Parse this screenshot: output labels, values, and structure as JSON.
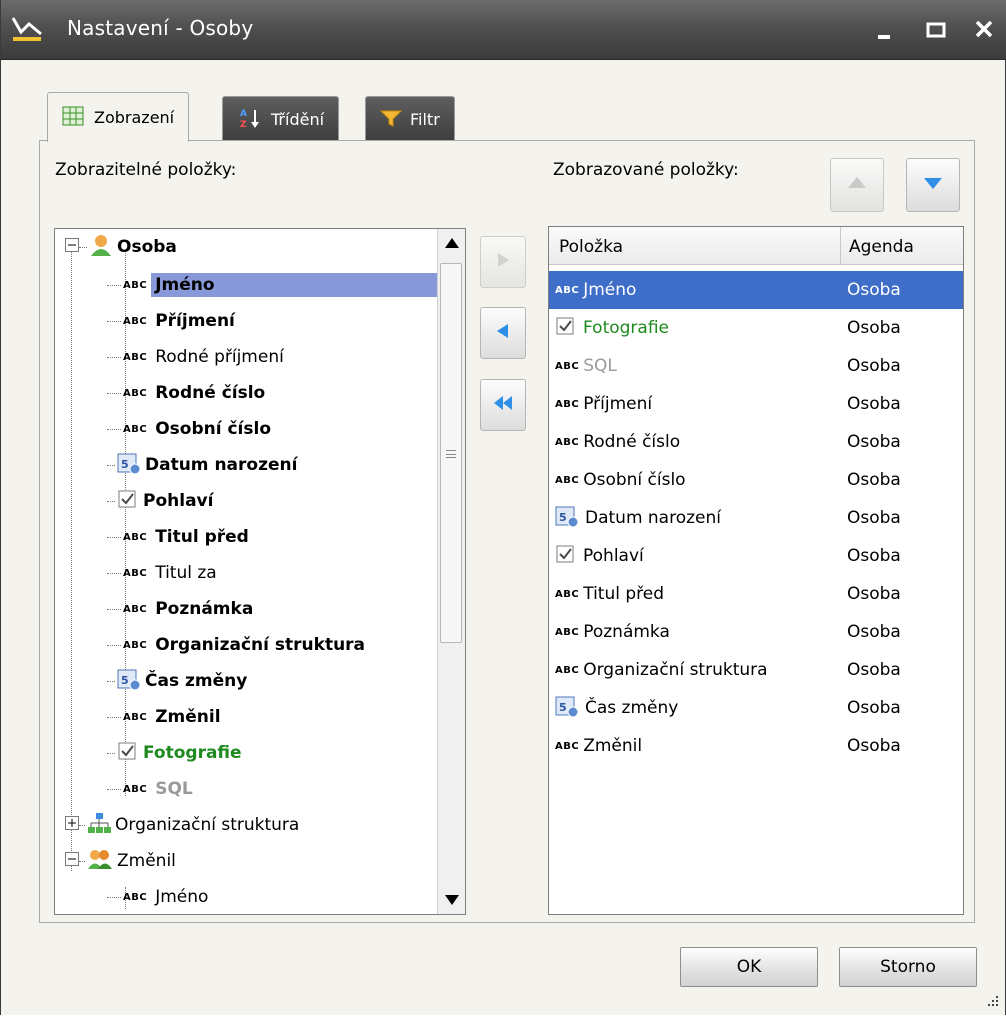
{
  "window": {
    "title": "Nastavení - Osoby"
  },
  "tabs": [
    {
      "label": "Zobrazení",
      "icon": "grid-icon",
      "active": true
    },
    {
      "label": "Třídění",
      "icon": "sort-az-icon",
      "active": false
    },
    {
      "label": "Filtr",
      "icon": "filter-icon",
      "active": false
    }
  ],
  "left_label": "Zobrazitelné položky:",
  "right_label": "Zobrazované položky:",
  "tree": {
    "items": [
      {
        "text": "Osoba",
        "icon": "person-icon",
        "level": 0,
        "bold": true,
        "expander": "minus"
      },
      {
        "text": "Jméno",
        "icon": "abc-icon",
        "level": 1,
        "bold": true,
        "selected": true
      },
      {
        "text": "Příjmení",
        "icon": "abc-icon",
        "level": 1,
        "bold": true
      },
      {
        "text": "Rodné příjmení",
        "icon": "abc-icon",
        "level": 1,
        "bold": false
      },
      {
        "text": "Rodné číslo",
        "icon": "abc-icon",
        "level": 1,
        "bold": true
      },
      {
        "text": "Osobní číslo",
        "icon": "abc-icon",
        "level": 1,
        "bold": true
      },
      {
        "text": "Datum narození",
        "icon": "calendar-icon",
        "level": 1,
        "bold": true
      },
      {
        "text": "Pohlaví",
        "icon": "checkbox-icon",
        "level": 1,
        "bold": true
      },
      {
        "text": "Titul před",
        "icon": "abc-icon",
        "level": 1,
        "bold": true
      },
      {
        "text": "Titul za",
        "icon": "abc-icon",
        "level": 1,
        "bold": false
      },
      {
        "text": "Poznámka",
        "icon": "abc-icon",
        "level": 1,
        "bold": true
      },
      {
        "text": "Organizační struktura",
        "icon": "abc-icon",
        "level": 1,
        "bold": true
      },
      {
        "text": "Čas změny",
        "icon": "calendar-icon",
        "level": 1,
        "bold": true
      },
      {
        "text": "Změnil",
        "icon": "abc-icon",
        "level": 1,
        "bold": true
      },
      {
        "text": "Fotografie",
        "icon": "checkbox-icon",
        "level": 1,
        "bold": true,
        "color": "green"
      },
      {
        "text": "SQL",
        "icon": "abc-icon",
        "level": 1,
        "bold": true,
        "color": "gray"
      },
      {
        "text": "Organizační struktura",
        "icon": "org-chart-icon",
        "level": 0,
        "bold": false,
        "expander": "plus"
      },
      {
        "text": "Změnil",
        "icon": "group-icon",
        "level": 0,
        "bold": false,
        "expander": "minus"
      },
      {
        "text": "Jméno",
        "icon": "abc-icon",
        "level": 1,
        "bold": false
      }
    ]
  },
  "grid": {
    "columns": [
      "Položka",
      "Agenda"
    ],
    "rows": [
      {
        "item": "Jméno",
        "icon": "abc-icon",
        "agenda": "Osoba",
        "selected": true
      },
      {
        "item": "Fotografie",
        "icon": "checkbox-icon",
        "agenda": "Osoba",
        "color": "green"
      },
      {
        "item": "SQL",
        "icon": "abc-icon",
        "agenda": "Osoba",
        "color": "gray"
      },
      {
        "item": "Příjmení",
        "icon": "abc-icon",
        "agenda": "Osoba"
      },
      {
        "item": "Rodné číslo",
        "icon": "abc-icon",
        "agenda": "Osoba"
      },
      {
        "item": "Osobní číslo",
        "icon": "abc-icon",
        "agenda": "Osoba"
      },
      {
        "item": "Datum narození",
        "icon": "calendar-icon",
        "agenda": "Osoba"
      },
      {
        "item": "Pohlaví",
        "icon": "checkbox-icon",
        "agenda": "Osoba"
      },
      {
        "item": "Titul před",
        "icon": "abc-icon",
        "agenda": "Osoba"
      },
      {
        "item": "Poznámka",
        "icon": "abc-icon",
        "agenda": "Osoba"
      },
      {
        "item": "Organizační struktura",
        "icon": "abc-icon",
        "agenda": "Osoba"
      },
      {
        "item": "Čas změny",
        "icon": "calendar-icon",
        "agenda": "Osoba"
      },
      {
        "item": "Změnil",
        "icon": "abc-icon",
        "agenda": "Osoba"
      }
    ]
  },
  "abc_glyph": "ABC",
  "buttons": {
    "ok": "OK",
    "cancel": "Storno"
  },
  "colors": {
    "titlebar": "#4a4a4a",
    "tree_selection": "#8799d8",
    "grid_selection": "#3f6ec9",
    "green_text": "#1e8a1e",
    "gray_text": "#9a9a9a"
  }
}
